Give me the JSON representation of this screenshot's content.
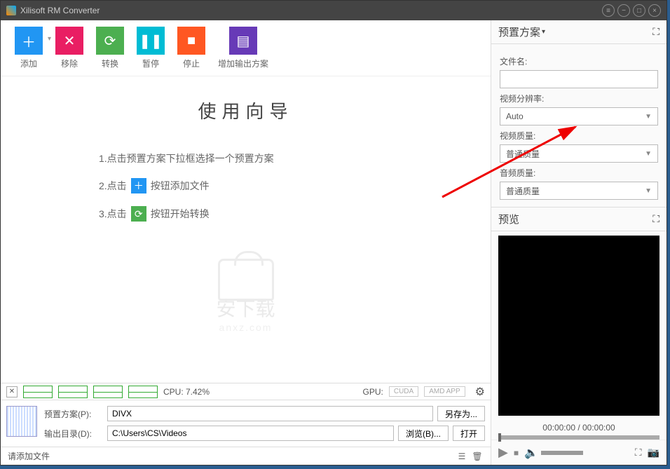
{
  "titlebar": {
    "title": "Xilisoft RM Converter"
  },
  "toolbar": {
    "add": "添加",
    "remove": "移除",
    "convert": "转换",
    "pause": "暂停",
    "stop": "停止",
    "addout": "增加输出方案"
  },
  "guide": {
    "title": "使用向导",
    "step1a": "1.点击预置方案下拉框选择一个预置方案",
    "step2a": "2.点击",
    "step2b": "按钮添加文件",
    "step3a": "3.点击",
    "step3b": "按钮开始转换"
  },
  "watermark": {
    "text1": "安下载",
    "text2": "anxz.com"
  },
  "sysbar": {
    "cpu": "CPU: 7.42%",
    "gpu_label": "GPU:",
    "cuda": "CUDA",
    "amd": "AMD APP"
  },
  "settings": {
    "preset_label": "预置方案(P):",
    "preset_value": "DIVX",
    "saveas": "另存为...",
    "outdir_label": "输出目录(D):",
    "outdir_value": "C:\\Users\\CS\\Videos",
    "browse": "浏览(B)...",
    "open": "打开"
  },
  "statusbar": {
    "msg": "请添加文件"
  },
  "presetPanel": {
    "title": "预置方案",
    "filename": "文件名:",
    "resolution_label": "视频分辨率:",
    "resolution_value": "Auto",
    "vquality_label": "视频质量:",
    "vquality_value": "普通质量",
    "aquality_label": "音频质量:",
    "aquality_value": "普通质量"
  },
  "preview": {
    "title": "预览",
    "time": "00:00:00 / 00:00:00"
  }
}
